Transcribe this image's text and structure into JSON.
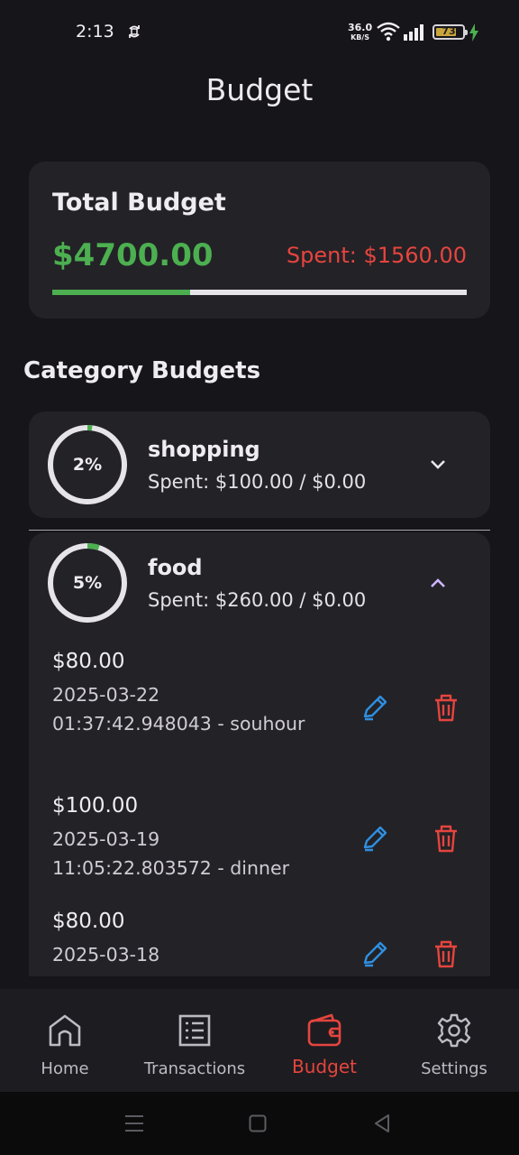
{
  "status": {
    "time": "2:13",
    "speed_value": "36.0",
    "speed_unit": "KB/S",
    "battery": "73"
  },
  "header": {
    "title": "Budget"
  },
  "total": {
    "title": "Total Budget",
    "amount": "$4700.00",
    "spent": "Spent: $1560.00",
    "progress": 0.332
  },
  "categories_title": "Category Budgets",
  "categories": [
    {
      "name": "shopping",
      "percent_label": "2%",
      "progress": 0.02,
      "spent": "Spent: $100.00 / $0.00",
      "expanded": false
    },
    {
      "name": "food",
      "percent_label": "5%",
      "progress": 0.05,
      "spent": "Spent: $260.00 / $0.00",
      "expanded": true,
      "transactions": [
        {
          "amount": "$80.00",
          "desc": "2025-03-22 01:37:42.948043 - souhour"
        },
        {
          "amount": "$100.00",
          "desc": "2025-03-19 11:05:22.803572 - dinner"
        },
        {
          "amount": "$80.00",
          "desc": "2025-03-18"
        }
      ]
    }
  ],
  "nav": [
    {
      "label": "Home",
      "icon": "home-icon"
    },
    {
      "label": "Transactions",
      "icon": "list-icon"
    },
    {
      "label": "Budget",
      "icon": "wallet-icon",
      "active": true
    },
    {
      "label": "Settings",
      "icon": "gear-icon"
    }
  ],
  "colors": {
    "accent_green": "#4caf50",
    "accent_red": "#e5453e",
    "edit_blue": "#2f8fe0",
    "chevron_purple": "#cdb6ff"
  }
}
